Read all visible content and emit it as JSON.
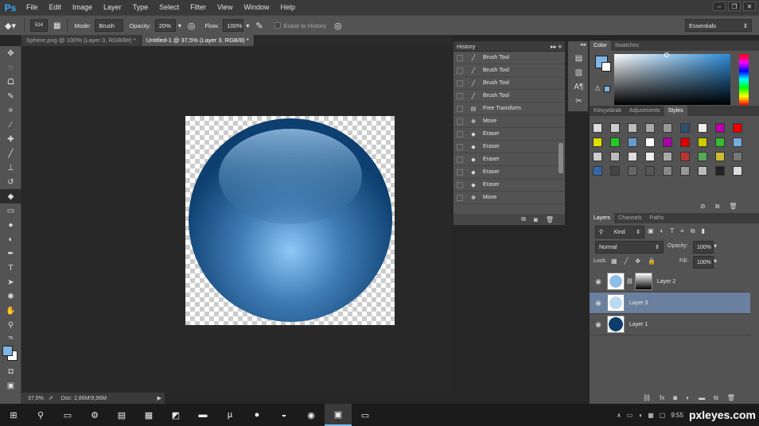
{
  "app": {
    "logo": "Ps"
  },
  "menu": [
    "File",
    "Edit",
    "Image",
    "Layer",
    "Type",
    "Select",
    "Filter",
    "View",
    "Window",
    "Help"
  ],
  "window_controls": [
    "–",
    "❐",
    "✕"
  ],
  "options": {
    "brush_size": "514",
    "mode_label": "Mode:",
    "mode_value": "Brush",
    "opacity_label": "Opacity:",
    "opacity_value": "20%",
    "flow_label": "Flow:",
    "flow_value": "100%",
    "erase_history": "Erase to History",
    "workspace": "Essentials"
  },
  "tabs": [
    {
      "label": "Sphere.png @ 100% (Layer 0, RGB/8#) *"
    },
    {
      "label": "Untitled-1 @ 37,5% (Layer 3, RGB/8) *"
    }
  ],
  "history": {
    "title": "History",
    "items": [
      "Brush Tool",
      "Brush Tool",
      "Brush Tool",
      "Brush Tool",
      "Free Transform",
      "Move",
      "Eraser",
      "Eraser",
      "Eraser",
      "Eraser",
      "Eraser",
      "Move"
    ]
  },
  "color_panel": {
    "tabs": [
      "Color",
      "Swatches"
    ],
    "fg_color": "#7fb6e6",
    "bg_color": "#ffffff"
  },
  "styles_panel": {
    "tabs": [
      "Könyvtárak",
      "Adjustments",
      "Styles"
    ]
  },
  "layers_panel": {
    "tabs": [
      "Layers",
      "Channels",
      "Paths"
    ],
    "filter": "Kind",
    "blend_mode": "Normal",
    "opacity_label": "Opacity:",
    "opacity_value": "100%",
    "lock_label": "Lock:",
    "fill_label": "Fill:",
    "fill_value": "100%",
    "layers": [
      {
        "name": "Layer 2"
      },
      {
        "name": "Layer 3"
      },
      {
        "name": "Layer 1"
      }
    ]
  },
  "status": {
    "zoom": "37,5%",
    "doc": "Doc: 2,86M/9,96M"
  },
  "taskbar": {
    "time": "9:55",
    "watermark": "pxleyes.com"
  }
}
